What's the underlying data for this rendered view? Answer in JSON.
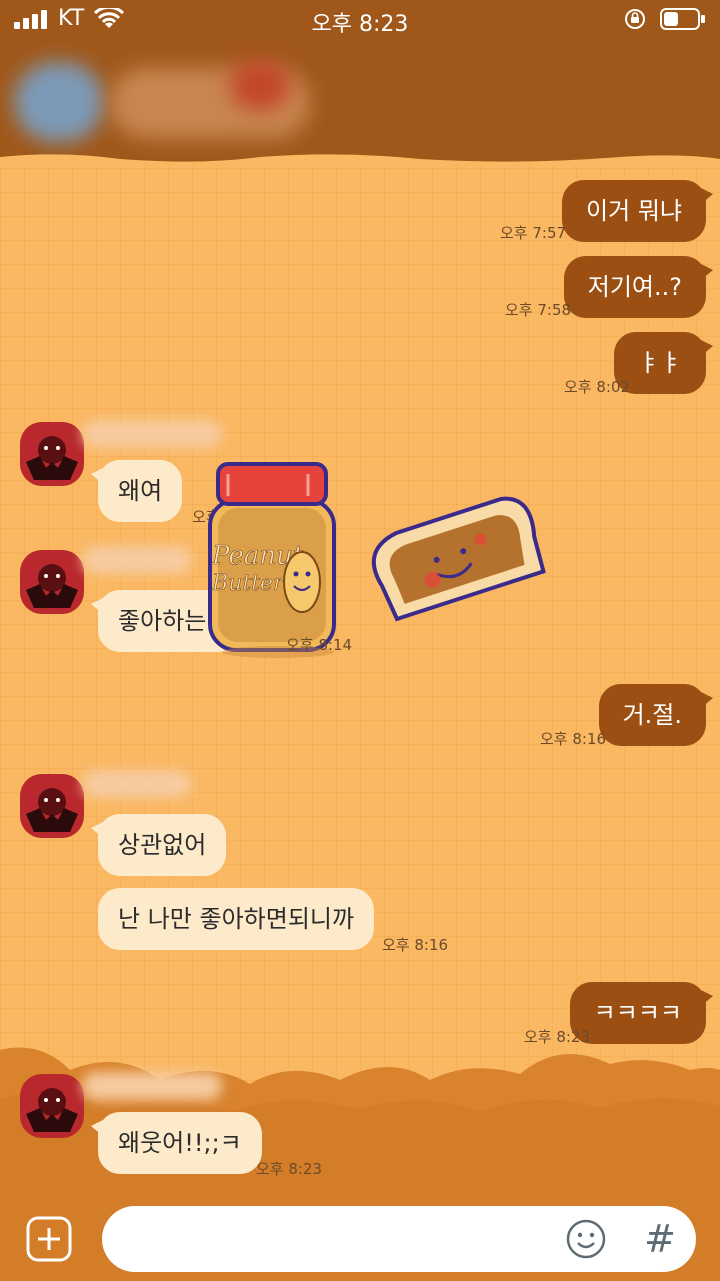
{
  "status_bar": {
    "carrier": "KT",
    "time": "오후 8:23"
  },
  "messages": [
    {
      "id": "m1",
      "dir": "out",
      "text": "이거 뭐냐",
      "time": "오후 7:57"
    },
    {
      "id": "m2",
      "dir": "out",
      "text": "저기여..?",
      "time": "오후 7:58"
    },
    {
      "id": "m3",
      "dir": "out",
      "text": "ㅑㅑ",
      "time": "오후 8:02"
    },
    {
      "id": "m4",
      "dir": "in",
      "text": "왜여",
      "time": "오후 8:13"
    },
    {
      "id": "m5",
      "dir": "in",
      "text": "좋아하는더 뭐",
      "time": "오후 8:14"
    },
    {
      "id": "m6",
      "dir": "out",
      "text": "거.절.",
      "time": "오후 8:16"
    },
    {
      "id": "m7",
      "dir": "in",
      "text": "상관없어",
      "time": ""
    },
    {
      "id": "m8",
      "dir": "in",
      "text": "난 나만 좋아하면되니까",
      "time": "오후 8:16"
    },
    {
      "id": "m9",
      "dir": "out",
      "text": "ㅋㅋㅋㅋ",
      "time": "오후 8:23"
    },
    {
      "id": "m10",
      "dir": "in",
      "text": "왜웃어!!;;ㅋ",
      "time": "오후 8:23"
    }
  ],
  "sticker": {
    "jar_text_line1": "Peanut",
    "jar_text_line2": "Butter"
  },
  "input": {
    "placeholder": ""
  },
  "colors": {
    "outgoing": "#9c4f12",
    "incoming": "#fdeacb",
    "background": "#fbb862",
    "header": "#a0581a"
  }
}
